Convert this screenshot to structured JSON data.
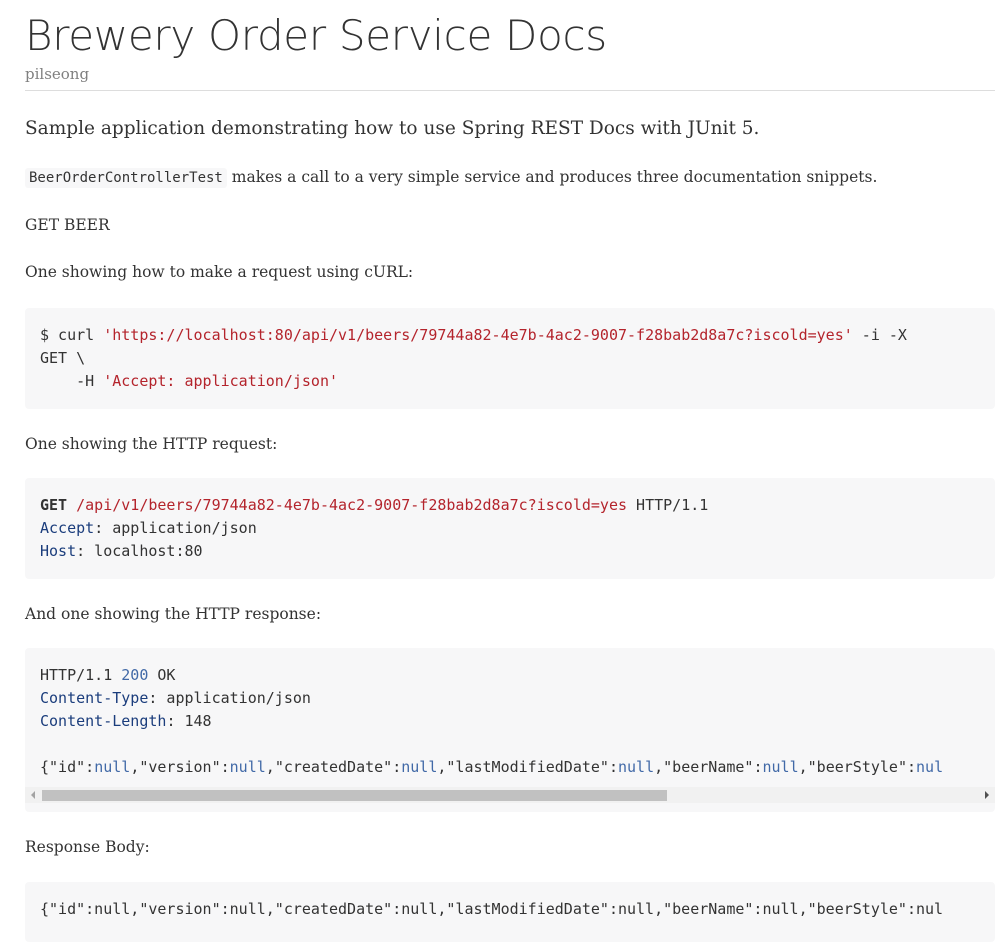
{
  "header": {
    "title": "Brewery Order Service Docs",
    "author": "pilseong"
  },
  "content": {
    "lead": "Sample application demonstrating how to use Spring REST Docs with JUnit 5.",
    "intro_code": "BeerOrderControllerTest",
    "intro_text": " makes a call to a very simple service and produces three documentation snippets.",
    "section_label": "GET BEER",
    "curl_label": "One showing how to make a request using cURL:",
    "http_request_label": "One showing the HTTP request:",
    "http_response_label": "And one showing the HTTP response:",
    "response_body_label": "Response Body:"
  },
  "curl": {
    "prompt": "$ curl ",
    "url": "'https://localhost:80/api/v1/beers/79744a82-4e7b-4ac2-9007-f28bab2d8a7c?iscold=yes'",
    "flags": " -i -X",
    "method_line": "GET \\",
    "header_flag": "    -H ",
    "header_value": "'Accept: application/json'"
  },
  "http_request": {
    "method": "GET",
    "path": "/api/v1/beers/79744a82-4e7b-4ac2-9007-f28bab2d8a7c?iscold=yes",
    "protocol": " HTTP/1.1",
    "accept_name": "Accept",
    "accept_value": ": application/json",
    "host_name": "Host",
    "host_value": ": localhost:80"
  },
  "http_response": {
    "protocol": "HTTP/1.1 ",
    "status_code": "200",
    "status_text": " OK",
    "content_type_name": "Content-Type",
    "content_type_value": ": application/json",
    "content_length_name": "Content-Length",
    "content_length_sep": ": ",
    "content_length_value": "148",
    "body": {
      "open": "{",
      "k1": "\"id\"",
      "v1": "null",
      "k2": "\"version\"",
      "v2": "null",
      "k3": "\"createdDate\"",
      "v3": "null",
      "k4": "\"lastModifiedDate\"",
      "v4": "null",
      "k5": "\"beerName\"",
      "v5": "null",
      "k6": "\"beerStyle\"",
      "v6": "nul"
    }
  },
  "response_body": {
    "text": "{\"id\":null,\"version\":null,\"createdDate\":null,\"lastModifiedDate\":null,\"beerName\":null,\"beerStyle\":nul"
  },
  "colors": {
    "string": "#b4242c",
    "number": "#4169a7",
    "attribute": "#1b3d7c",
    "code_background": "#f7f7f8"
  }
}
